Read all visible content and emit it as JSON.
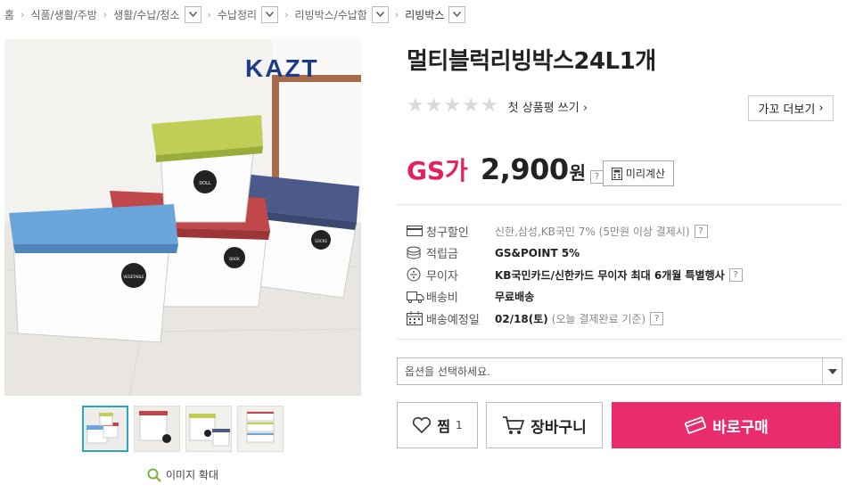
{
  "breadcrumb": {
    "home": "홈",
    "items": [
      "식품/생활/주방",
      "생활/수납/청소",
      "수납정리",
      "리빙박스/수납함",
      "리빙박스"
    ]
  },
  "product": {
    "brand_logo": "KAZT",
    "box_labels": [
      "DOLL",
      "VEGETABLE",
      "BOOK",
      "SOCKS"
    ],
    "title": "멀티블럭리빙박스24L1개",
    "review_link": "첫 상품평 쓰기",
    "more_button": "가꼬 더보기",
    "price_prefix": "GS가",
    "price": "2,900",
    "price_unit": "원",
    "calc_button": "미리계산",
    "help_mark": "?",
    "rating_stars": 0
  },
  "info": {
    "rows": [
      {
        "label": "청구할인",
        "value": "",
        "sub": "신한,삼성,KB국민 7% (5만원 이상 결제시)",
        "icon": "card-icon",
        "help": true
      },
      {
        "label": "적립금",
        "value": "GS&POINT 5%",
        "sub": "",
        "icon": "coins-icon",
        "help": false
      },
      {
        "label": "무이자",
        "value": "KB국민카드/신한카드 무이자 최대 6개월 특별행사",
        "sub": "",
        "icon": "installment-icon",
        "help": true
      },
      {
        "label": "배송비",
        "value": "무료배송",
        "sub": "",
        "icon": "truck-icon",
        "help": false
      },
      {
        "label": "배송예정일",
        "value": "02/18(토)",
        "sub": "(오늘 결제완료 기준)",
        "icon": "calendar-icon",
        "help": true
      }
    ]
  },
  "option": {
    "placeholder": "옵션을 선택하세요."
  },
  "actions": {
    "wish_label": "찜",
    "wish_count": "1",
    "cart_label": "장바구니",
    "buy_label": "바로구매"
  },
  "gallery": {
    "zoom_label": "이미지 확대",
    "thumb_count": 4
  },
  "colors": {
    "accent": "#e92c6b",
    "gs": "#e6205a",
    "thumb_active": "#2aa6b6"
  }
}
